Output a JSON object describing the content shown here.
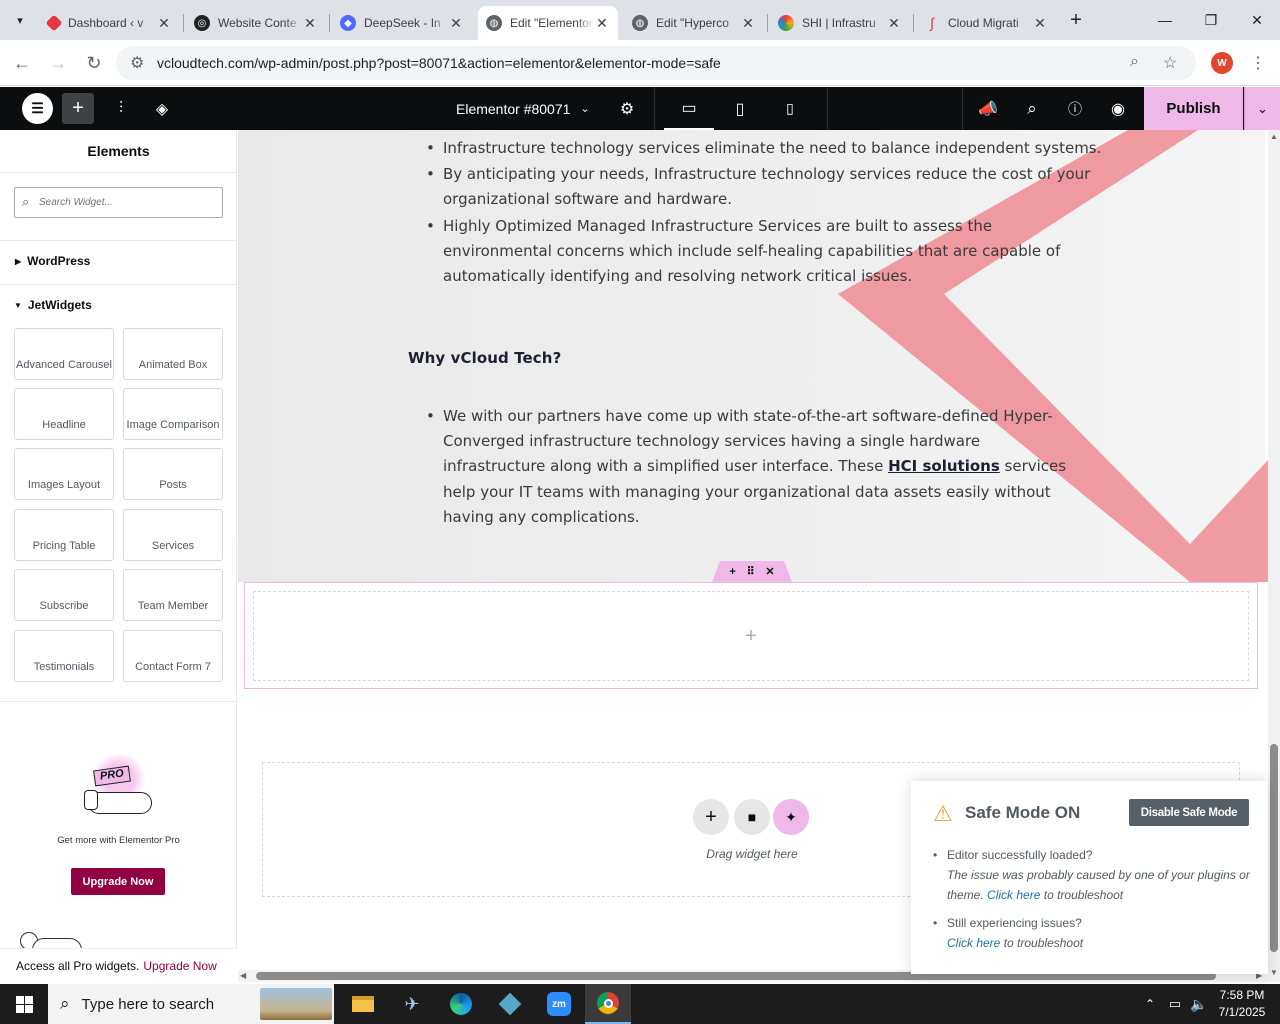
{
  "browser": {
    "tabs": [
      {
        "title": "Dashboard ‹ v",
        "fav_color": "#e2383f"
      },
      {
        "title": "Website Conte",
        "fav_color": "#202124"
      },
      {
        "title": "DeepSeek - In",
        "fav_color": "#4d6bfe"
      },
      {
        "title": "Edit \"Elementor",
        "fav_color": "#5f6368"
      },
      {
        "title": "Edit \"Hyperco",
        "fav_color": "#5f6368"
      },
      {
        "title": "SHI | Infrastru",
        "fav_color": "#e8412f"
      },
      {
        "title": "Cloud Migrati",
        "fav_color": "#e2383f"
      }
    ],
    "url": "vcloudtech.com/wp-admin/post.php?post=80071&action=elementor&elementor-mode=safe",
    "profile_initial": "W"
  },
  "editor": {
    "document_title": "Elementor #80071",
    "publish_label": "Publish"
  },
  "panel": {
    "title": "Elements",
    "search_placeholder": "Search Widget...",
    "categories": [
      {
        "label": "WordPress",
        "expanded": false
      },
      {
        "label": "JetWidgets",
        "expanded": true
      }
    ],
    "widgets": [
      "Advanced Carousel",
      "Animated Box",
      "Headline",
      "Image Comparison",
      "Images Layout",
      "Posts",
      "Pricing Table",
      "Services",
      "Subscribe",
      "Team Member",
      "Testimonials",
      "Contact Form 7"
    ],
    "pro_badge": "PRO",
    "promo_text": "Get more with Elementor Pro",
    "upgrade_button": "Upgrade Now",
    "footer_text": "Access all Pro widgets.",
    "footer_link": "Upgrade Now"
  },
  "content": {
    "bullets_top": [
      "Infrastructure technology services eliminate the need to balance independent systems.",
      "By anticipating your needs, Infrastructure technology services reduce the cost of your organizational software and hardware.",
      "Highly Optimized Managed Infrastructure Services are built to assess the environmental concerns which include self-healing capabilities that are capable of automatically identifying and resolving network critical issues."
    ],
    "heading": "Why vCloud Tech?",
    "para_before_link": "We with our partners have come up with state-of-the-art software-defined Hyper-Converged infrastructure technology services having a single hardware infrastructure along with a simplified user interface. These",
    "link_text": "HCI solutions",
    "para_after_link": "services help your IT teams with managing your organizational data assets easily without having any complications.",
    "drag_text": "Drag widget here"
  },
  "safe_mode": {
    "title": "Safe Mode ON",
    "disable_button": "Disable Safe Mode",
    "item1_title": "Editor successfully loaded?",
    "item1_text": "The issue was probably caused by one of your plugins or theme.",
    "item1_link": "Click here",
    "item1_suffix": "to troubleshoot",
    "item2_title": "Still experiencing issues?",
    "item2_link": "Click here",
    "item2_suffix": "to troubleshoot"
  },
  "taskbar": {
    "search_placeholder": "Type here to search",
    "time": "7:58 PM",
    "date": "7/1/2025"
  },
  "colors": {
    "accent_pink": "#f0b8e8",
    "upgrade_bg": "#93003f",
    "diagonal": "#ef8a92"
  }
}
